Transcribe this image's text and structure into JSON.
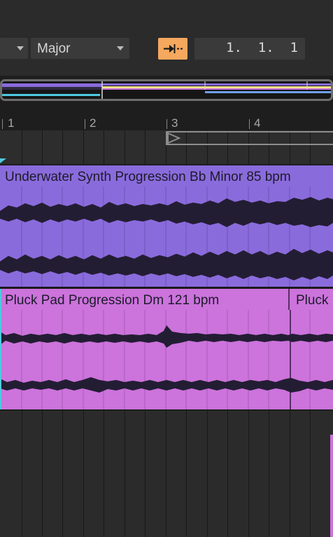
{
  "toolbar": {
    "scale_dropdown_left": "",
    "scale_dropdown_value": "Major",
    "follow_icon": "follow-arrow-icon",
    "position": "1.  1.  1"
  },
  "ruler": {
    "bars": [
      "1",
      "2",
      "3",
      "4"
    ]
  },
  "clips": [
    {
      "name": "Underwater Synth Progression Bb Minor 85 bpm",
      "color": "#8a6bdc"
    },
    {
      "name": "Pluck Pad Progression Dm 121 bpm",
      "color": "#cc73dc"
    },
    {
      "name": "Pluck",
      "color": "#cc73dc"
    }
  ],
  "colors": {
    "accent_orange": "#f5a85e",
    "clip_purple": "#8a6bdc",
    "clip_pink": "#cc73dc",
    "playhead_cyan": "#4ec9e0"
  }
}
